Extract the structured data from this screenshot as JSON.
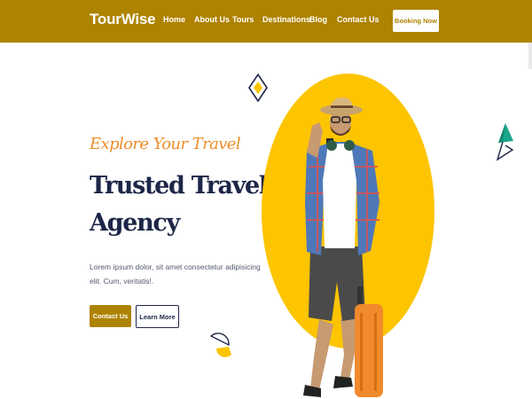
{
  "header": {
    "brand": "TourWise",
    "nav": [
      "Home",
      "About Us",
      "Tours",
      "Destinations",
      "Blog",
      "Contact Us"
    ],
    "cta": "Booking Now"
  },
  "hero": {
    "script_tagline": "Explore Your Travel",
    "headline_line1": "Trusted Travel",
    "headline_line2": "Agency",
    "description": "Lorem ipsum dolor, sit amet consectetur adipisicing elit. Cum, veritatis!.",
    "primary_button": "Contact Us",
    "secondary_button": "Learn More"
  },
  "colors": {
    "brand": "#ae8300",
    "accent_yellow": "#fdc400",
    "script_orange": "#ec8e2b",
    "heading_navy": "#1e2648",
    "teal": "#1aa68a"
  },
  "icons": [
    "diamond-decoration-icon",
    "paper-plane-icon",
    "half-circle-decoration-icon"
  ]
}
